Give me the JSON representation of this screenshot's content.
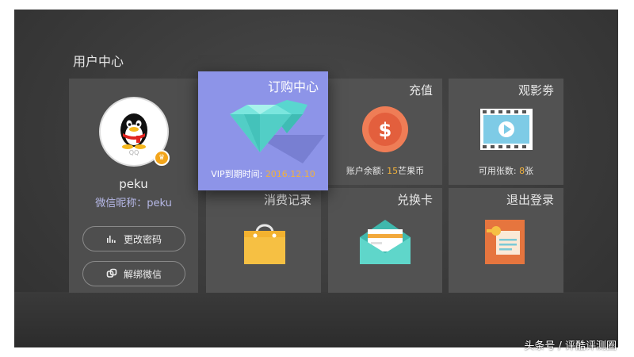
{
  "screen": {
    "title": "用户中心"
  },
  "profile": {
    "username": "peku",
    "wechat_label": "微信昵称：peku",
    "qq_badge": "QQ",
    "change_password": "更改密码",
    "unbind_wechat": "解绑微信"
  },
  "tiles": {
    "vip": {
      "title": "订购中心",
      "caption_label": "VIP到期时间:",
      "caption_value": "2016.12.10"
    },
    "recharge": {
      "title": "充值",
      "caption_label": "账户余额:",
      "caption_value": "15",
      "caption_unit": "芒果币"
    },
    "tickets": {
      "title": "观影劵",
      "caption_label": "可用张数:",
      "caption_value": "8",
      "caption_unit": "张"
    },
    "history": {
      "title": "消费记录"
    },
    "redeem": {
      "title": "兑换卡"
    },
    "logout": {
      "title": "退出登录"
    }
  },
  "watermark": "头条号 / 评酷评测圈",
  "colors": {
    "accent_vip": "#8d94e8",
    "highlight": "#f2b23c",
    "tile": "#525252"
  }
}
